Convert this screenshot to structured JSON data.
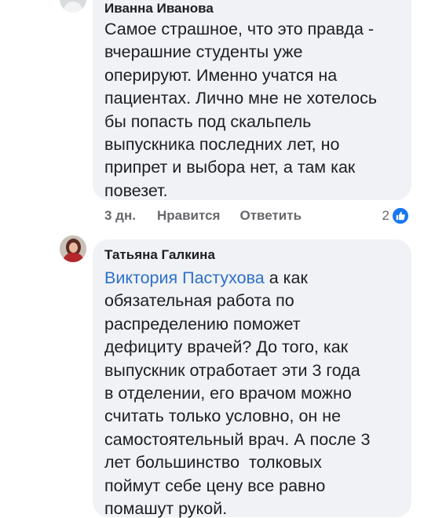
{
  "comment1": {
    "author": "Иванна Иванова",
    "text": "Самое страшное, что это правда -\nвчерашние студенты уже\nоперируют. Именно учатся на\nпациентах. Лично мне не хотелось\nбы попасть под скальпель\nвыпускника последних лет, но\nприпрет и выбора нет, а там как\nповезет.",
    "time": "3 дн.",
    "like_label": "Нравится",
    "reply_label": "Ответить",
    "reaction_count": "2",
    "reaction_icon": "thumbs-up-icon"
  },
  "comment2": {
    "author": "Татьяна Галкина",
    "mention": "Виктория Пастухова",
    "text_after_mention": " а как\nобязательная работа по\nраспределению поможет\nдефициту врачей? До того, как\nвыпускник отработает эти 3 года\nв отделении, его врачом можно\nсчитать только условно, он не\nсамостоятельный врач. А после 3\nлет большинство  толковых\nпоймут себе цену все равно\nпомашут рукой."
  },
  "colors": {
    "bubble": "#f0f2f5",
    "text": "#1c1e21",
    "secondary": "#65676b",
    "link": "#2d70c8",
    "like_blue": "#1877f2"
  }
}
